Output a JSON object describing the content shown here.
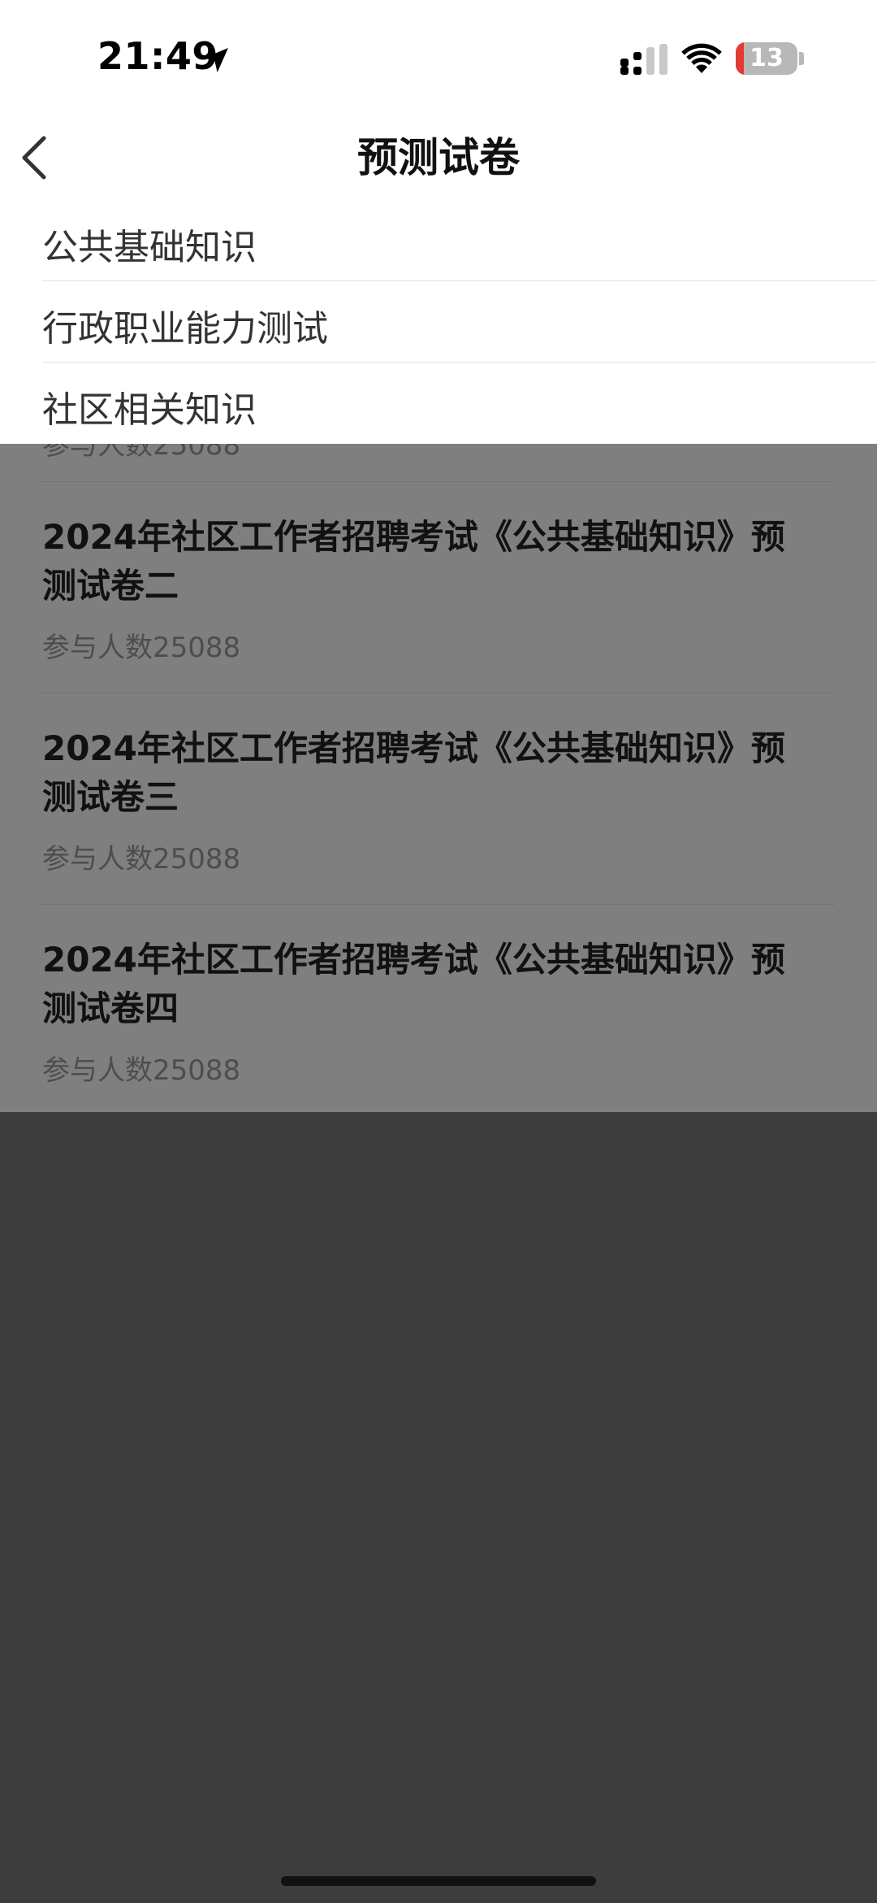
{
  "status_bar": {
    "time": "21:49",
    "battery_level": "13",
    "battery_fraction": 0.13,
    "icons": [
      "location-arrow-icon",
      "cellular-signal-icon",
      "wifi-icon",
      "battery-icon"
    ]
  },
  "header": {
    "title": "预测试卷",
    "back_icon": "chevron-left-icon"
  },
  "category_menu": {
    "items": [
      {
        "label": "公共基础知识"
      },
      {
        "label": "行政职业能力测试"
      },
      {
        "label": "社区相关知识"
      }
    ]
  },
  "exam_list": {
    "partial_item_meta": "参与人数25088",
    "items": [
      {
        "title": "2024年社区工作者招聘考试《公共基础知识》预测试卷二",
        "meta": "参与人数25088"
      },
      {
        "title": "2024年社区工作者招聘考试《公共基础知识》预测试卷三",
        "meta": "参与人数25088"
      },
      {
        "title": "2024年社区工作者招聘考试《公共基础知识》预测试卷四",
        "meta": "参与人数25088"
      }
    ]
  },
  "colors": {
    "overlay": "#7a7a7a",
    "battery_low": "#e53935",
    "panel": "#ffffff"
  }
}
